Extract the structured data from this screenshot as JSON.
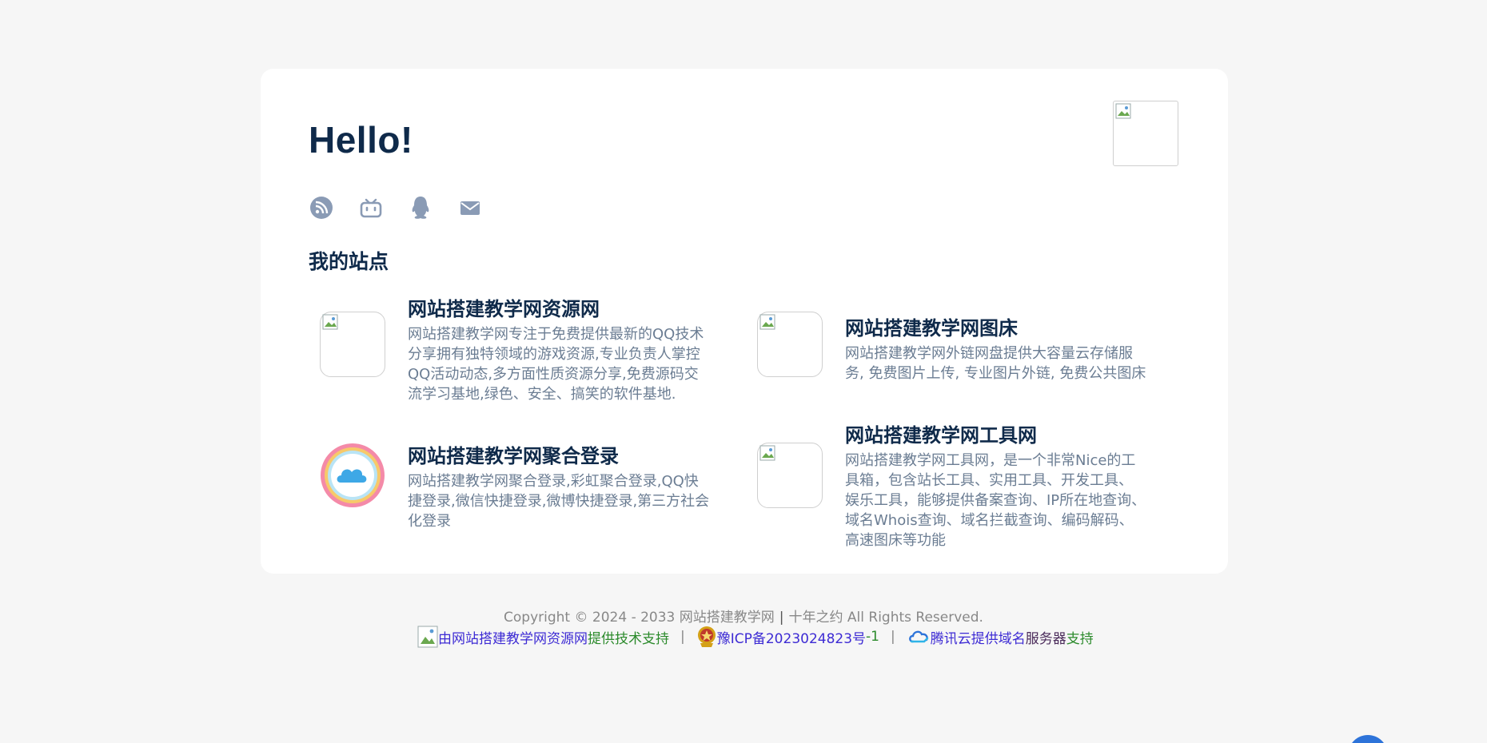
{
  "header": {
    "greeting": "Hello!"
  },
  "social_icons": [
    "rss-icon",
    "bilibili-icon",
    "qq-icon",
    "mail-icon"
  ],
  "sites_section": {
    "title": "我的站点",
    "items": [
      {
        "title": "网站搭建教学网资源网",
        "desc_lines": [
          "网站搭建教学网专注于免费提供最新的QQ技术",
          "分享拥有独特领域的游戏资源,专业负责人掌控",
          "QQ活动动态,多方面性质资源分享,免费源码交",
          "流学习基地,绿色、安全、搞笑的软件基地."
        ]
      },
      {
        "title": "网站搭建教学网图床",
        "desc_lines": [
          "网站搭建教学网外链网盘提供大容量云存储服",
          "务, 免费图片上传, 专业图片外链, 免费公共图床"
        ]
      },
      {
        "title": "网站搭建教学网聚合登录",
        "desc_lines": [
          "网站搭建教学网聚合登录,彩虹聚合登录,QQ快",
          "捷登录,微信快捷登录,微博快捷登录,第三方社会",
          "化登录"
        ]
      },
      {
        "title": "网站搭建教学网工具网",
        "desc_lines": [
          "网站搭建教学网工具网，是一个非常Nice的工",
          "具箱，包含站长工具、实用工具、开发工具、",
          "娱乐工具，能够提供备案查询、IP所在地查询、",
          "域名Whois查询、域名拦截查询、编码解码、",
          "高速图床等功能"
        ]
      }
    ]
  },
  "footer": {
    "copyright": "Copyright © 2024 - 2033 网站搭建教学网",
    "separator": "|",
    "slogan": "十年之约 All Rights Reserved.",
    "support_link": "由网站搭建教学网资源网",
    "support_suffix": "提供技术支持",
    "icp_link": "豫ICP备2023024823号",
    "icp_suffix": "-1",
    "cloud_link": "腾讯云提供域名",
    "cloud_mid": " 服务器",
    "cloud_suffix": "支持",
    "pipe": "|"
  },
  "colors": {
    "background": "#f6f6f6",
    "card": "#ffffff",
    "heading": "#0f2a4a",
    "muted_text": "#6b7d93",
    "icon": "#8a9bb5",
    "link": "#3d2bd4",
    "green": "#2b8a2b"
  }
}
